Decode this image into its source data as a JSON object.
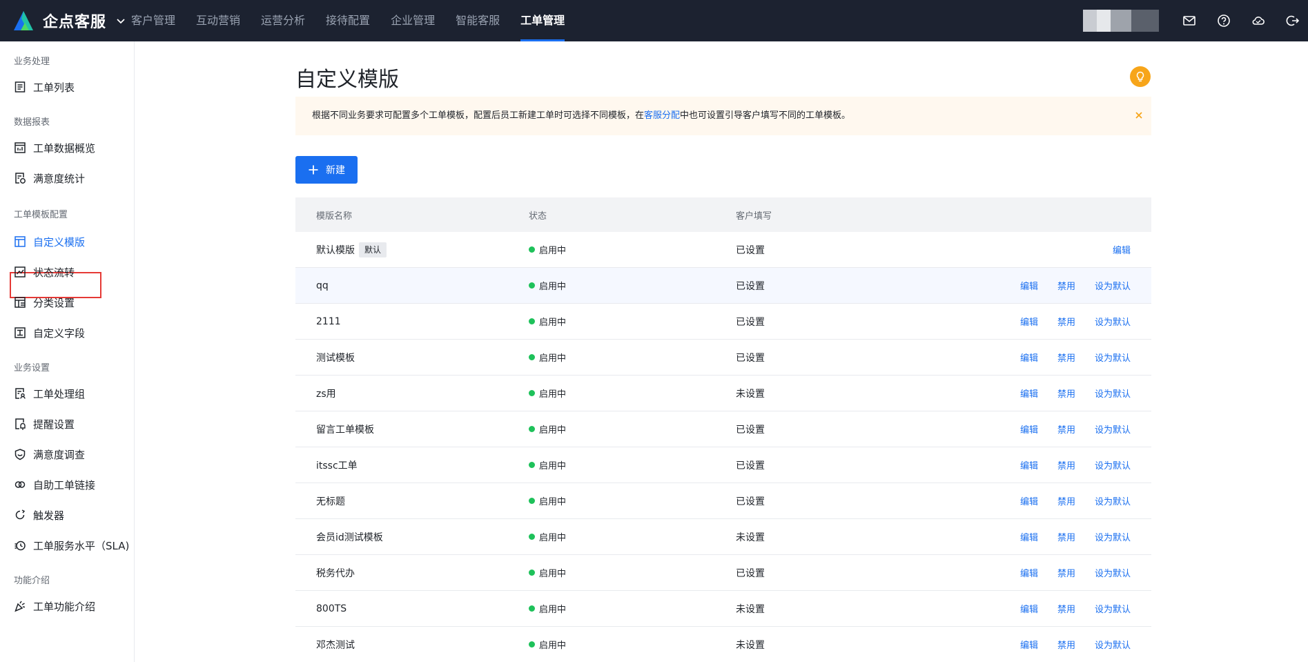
{
  "header": {
    "brand": "企点客服",
    "nav": [
      "客户管理",
      "互动营销",
      "运营分析",
      "接待配置",
      "企业管理",
      "智能客服",
      "工单管理"
    ],
    "active_nav": "工单管理",
    "icons": [
      "mail-icon",
      "help-icon",
      "cloud-icon",
      "logout-icon"
    ]
  },
  "sidebar": {
    "groups": [
      {
        "label": "业务处理",
        "items": [
          {
            "label": "工单列表",
            "icon": "list-icon"
          }
        ]
      },
      {
        "label": "数据报表",
        "items": [
          {
            "label": "工单数据概览",
            "icon": "chart-icon"
          },
          {
            "label": "满意度统计",
            "icon": "survey-stat-icon"
          }
        ]
      },
      {
        "label": "工单模板配置",
        "items": [
          {
            "label": "自定义模版",
            "icon": "template-icon"
          },
          {
            "label": "状态流转",
            "icon": "flow-icon"
          },
          {
            "label": "分类设置",
            "icon": "category-icon"
          },
          {
            "label": "自定义字段",
            "icon": "field-icon"
          }
        ]
      },
      {
        "label": "业务设置",
        "items": [
          {
            "label": "工单处理组",
            "icon": "group-icon"
          },
          {
            "label": "提醒设置",
            "icon": "reminder-icon"
          },
          {
            "label": "满意度调查",
            "icon": "shield-icon"
          },
          {
            "label": "自助工单链接",
            "icon": "link-icon"
          },
          {
            "label": "触发器",
            "icon": "trigger-icon"
          },
          {
            "label": "工单服务水平（SLA)",
            "icon": "clock-icon"
          }
        ]
      },
      {
        "label": "功能介绍",
        "items": [
          {
            "label": "工单功能介绍",
            "icon": "party-icon"
          }
        ]
      }
    ],
    "active_item": "自定义模版"
  },
  "main": {
    "title": "自定义模版",
    "notice": {
      "before": "根据不同业务要求可配置多个工单模板，配置后员工新建工单时可选择不同模板，在",
      "link": "客服分配",
      "after": "中也可设置引导客户填写不同的工单模板。"
    },
    "new_button": "新建",
    "columns": [
      "模版名称",
      "状态",
      "客户填写"
    ],
    "rows": [
      {
        "name": "默认模版",
        "tag": "默认",
        "status": "启用中",
        "fill": "已设置",
        "actions": [
          "编辑"
        ]
      },
      {
        "name": "qq",
        "status": "启用中",
        "fill": "已设置",
        "actions": [
          "编辑",
          "禁用",
          "设为默认"
        ]
      },
      {
        "name": "2111",
        "status": "启用中",
        "fill": "已设置",
        "actions": [
          "编辑",
          "禁用",
          "设为默认"
        ]
      },
      {
        "name": "测试模板",
        "status": "启用中",
        "fill": "已设置",
        "actions": [
          "编辑",
          "禁用",
          "设为默认"
        ]
      },
      {
        "name": "zs用",
        "status": "启用中",
        "fill": "未设置",
        "actions": [
          "编辑",
          "禁用",
          "设为默认"
        ]
      },
      {
        "name": "留言工单模板",
        "status": "启用中",
        "fill": "已设置",
        "actions": [
          "编辑",
          "禁用",
          "设为默认"
        ]
      },
      {
        "name": "itssc工单",
        "status": "启用中",
        "fill": "已设置",
        "actions": [
          "编辑",
          "禁用",
          "设为默认"
        ]
      },
      {
        "name": "无标题",
        "status": "启用中",
        "fill": "已设置",
        "actions": [
          "编辑",
          "禁用",
          "设为默认"
        ]
      },
      {
        "name": "会员id测试模板",
        "status": "启用中",
        "fill": "未设置",
        "actions": [
          "编辑",
          "禁用",
          "设为默认"
        ]
      },
      {
        "name": "税务代办",
        "status": "启用中",
        "fill": "已设置",
        "actions": [
          "编辑",
          "禁用",
          "设为默认"
        ]
      },
      {
        "name": "800TS",
        "status": "启用中",
        "fill": "未设置",
        "actions": [
          "编辑",
          "禁用",
          "设为默认"
        ]
      },
      {
        "name": "邓杰测试",
        "status": "启用中",
        "fill": "未设置",
        "actions": [
          "编辑",
          "禁用",
          "设为默认"
        ]
      }
    ]
  },
  "colors": {
    "accent": "#1a6ff0",
    "topbar": "#1c2230",
    "status_on": "#1ec15a",
    "highlight": "#e53935",
    "notice_bg": "#fff8ef",
    "bulb": "#f7a51a"
  }
}
